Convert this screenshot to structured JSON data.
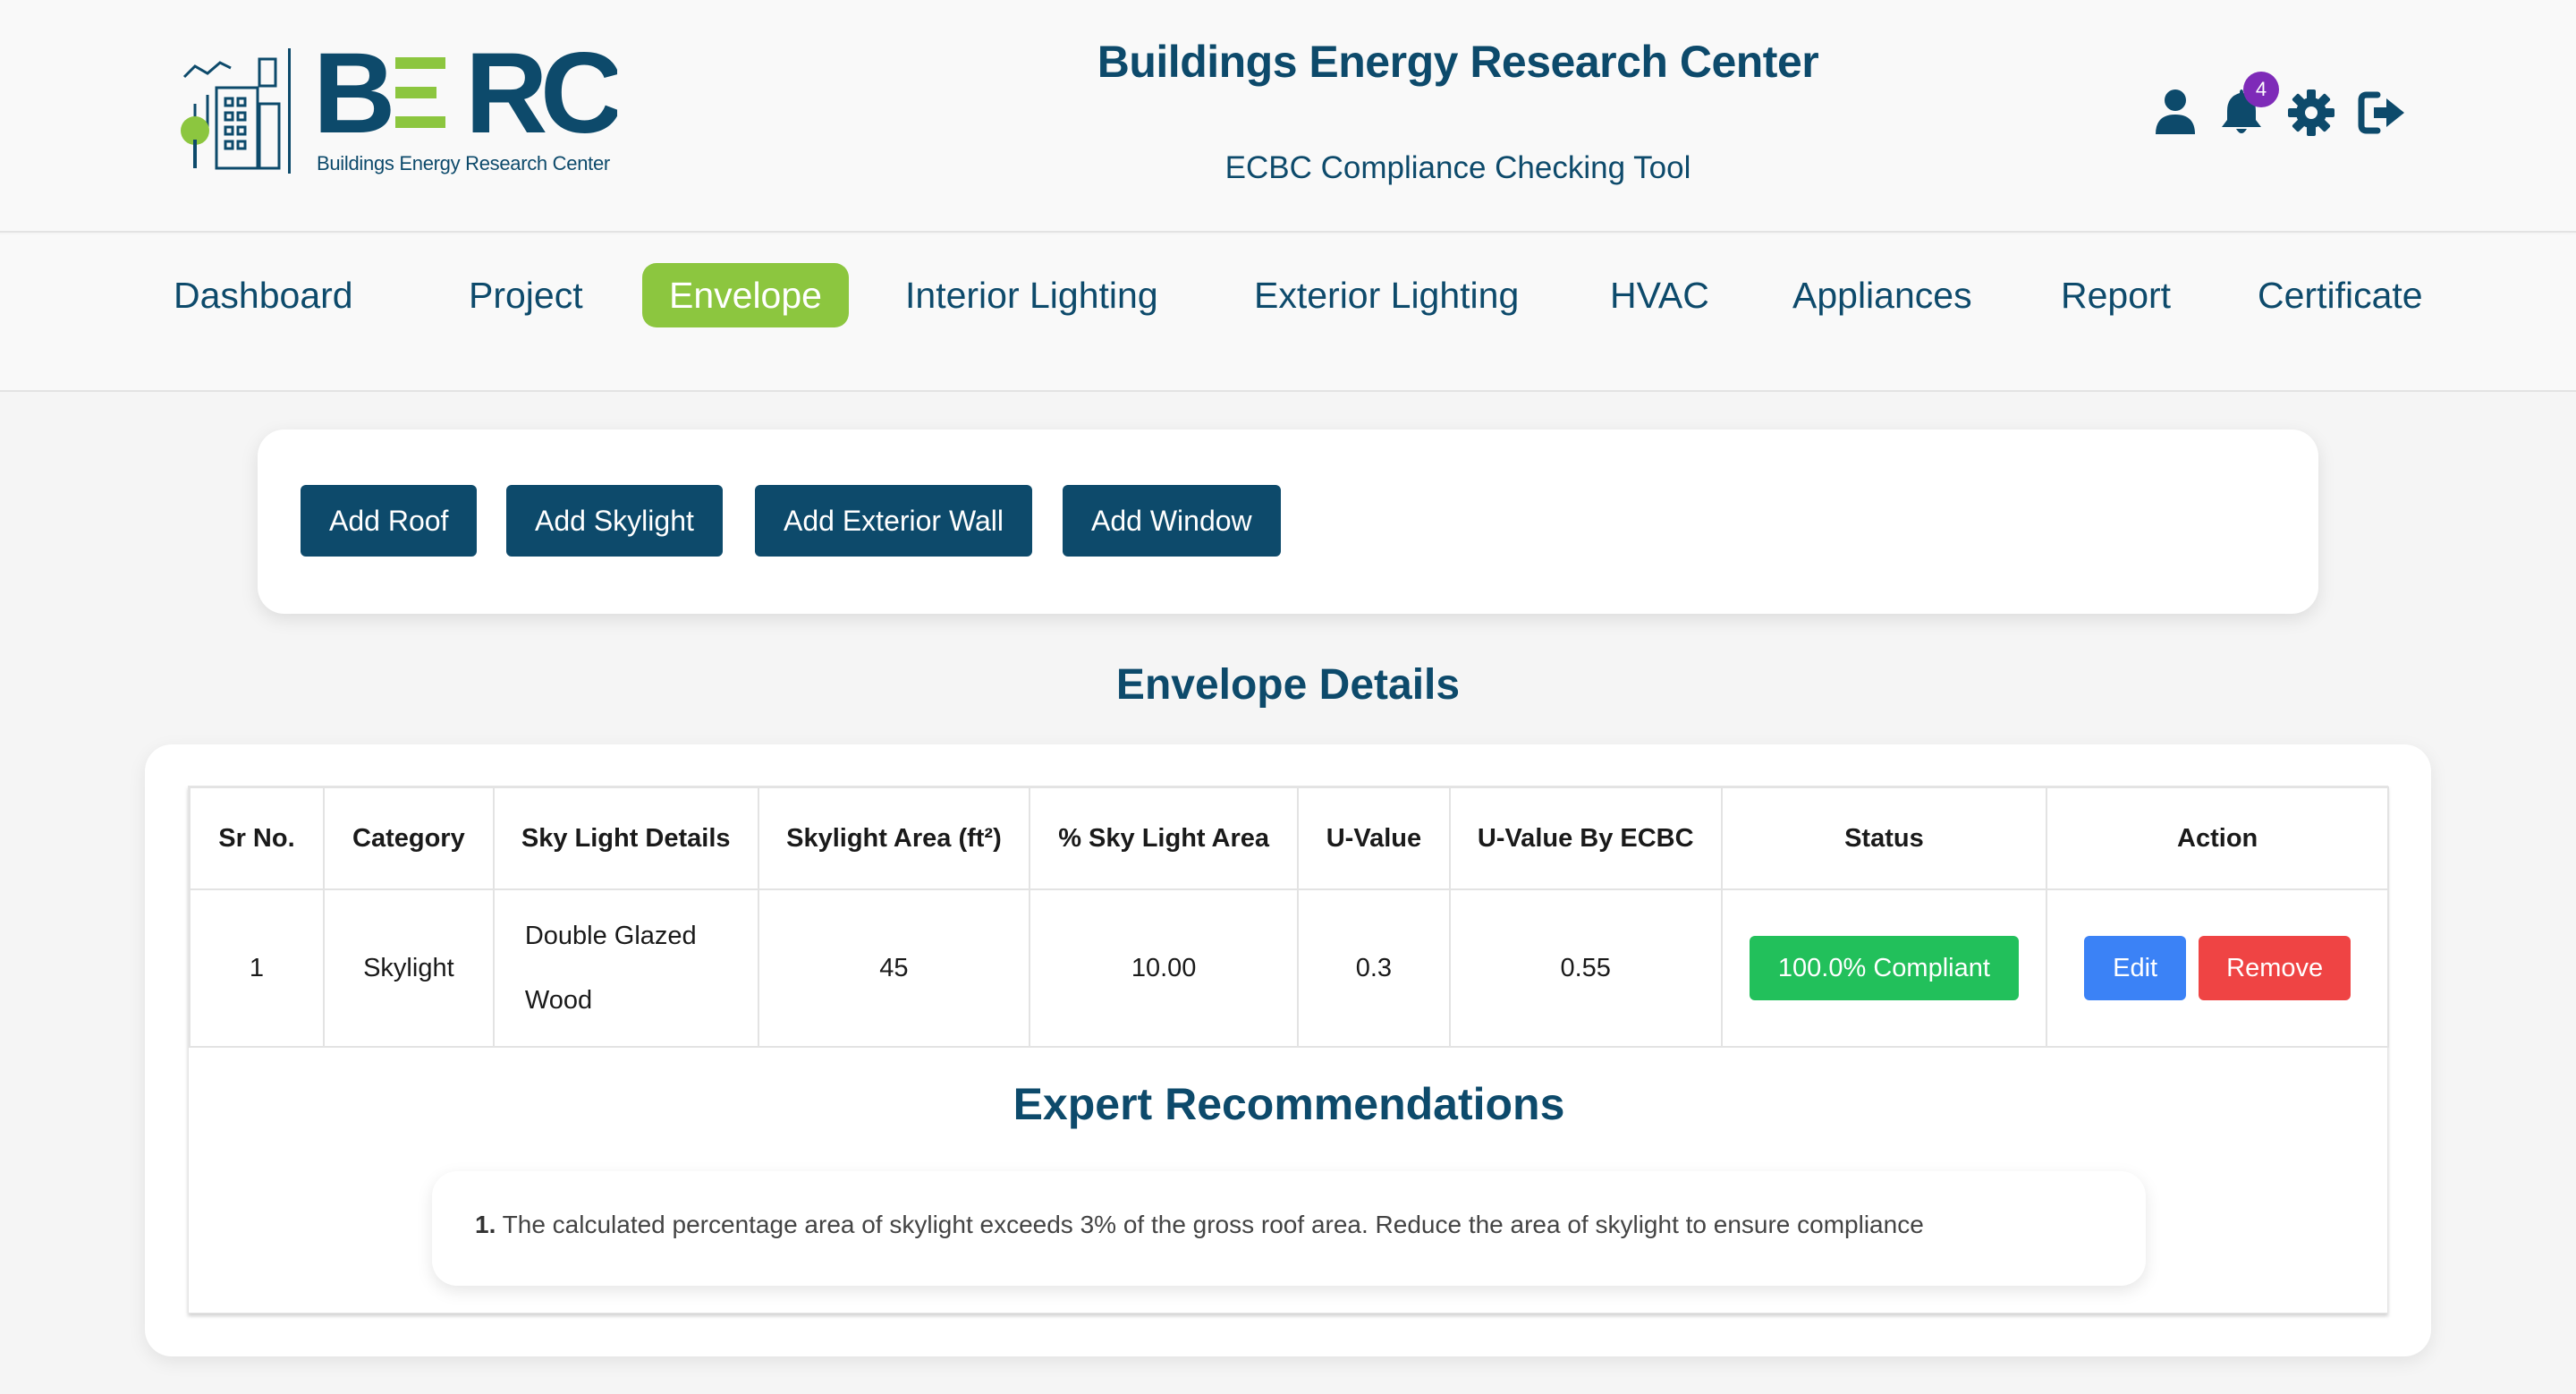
{
  "header": {
    "logo_text": "BERC",
    "logo_subtitle": "Buildings Energy Research Center",
    "title": "Buildings Energy Research Center",
    "subtitle": "ECBC Compliance Checking Tool",
    "notification_count": "4",
    "icons": [
      "user-icon",
      "bell-icon",
      "gear-icon",
      "logout-icon"
    ]
  },
  "nav": {
    "items": [
      {
        "label": "Dashboard"
      },
      {
        "label": "Project"
      },
      {
        "label": "Envelope",
        "active": true
      },
      {
        "label": "Interior Lighting"
      },
      {
        "label": "Exterior Lighting"
      },
      {
        "label": "HVAC"
      },
      {
        "label": "Appliances"
      },
      {
        "label": "Report"
      },
      {
        "label": "Certificate"
      }
    ]
  },
  "toolbar": {
    "buttons": [
      "Add Roof",
      "Add Skylight",
      "Add Exterior Wall",
      "Add Window"
    ]
  },
  "section_title": "Envelope Details",
  "table": {
    "headers": [
      "Sr No.",
      "Category",
      "Sky Light Details",
      "Skylight Area (ft²)",
      "% Sky Light Area",
      "U-Value",
      "U-Value By ECBC",
      "Status",
      "Action"
    ],
    "rows": [
      {
        "sr_no": "1",
        "category": "Skylight",
        "details_line1": "Double Glazed",
        "details_line2": "Wood",
        "area": "45",
        "percent_area": "10.00",
        "u_value": "0.3",
        "u_value_ecbc": "0.55",
        "status": "100.0% Compliant",
        "edit_label": "Edit",
        "remove_label": "Remove"
      }
    ]
  },
  "recommendations": {
    "title": "Expert Recommendations",
    "items": [
      {
        "number": "1.",
        "text": "The calculated percentage area of skylight exceeds 3% of the gross roof area. Reduce the area of skylight to ensure compliance"
      }
    ]
  },
  "colors": {
    "brand": "#0d4a6b",
    "accent": "#8cc63f",
    "compliant": "#22c05b",
    "edit": "#3b82f6",
    "remove": "#ef4444",
    "badge": "#7e2bb8"
  }
}
